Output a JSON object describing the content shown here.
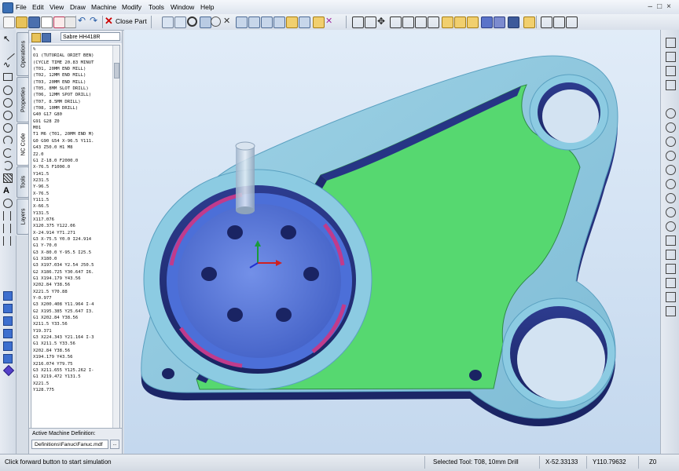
{
  "menu": [
    "File",
    "Edit",
    "View",
    "Draw",
    "Machine",
    "Modify",
    "Tools",
    "Window",
    "Help"
  ],
  "toolbar": {
    "close_part_label": "Close Part"
  },
  "left_tools": [
    "pointer-icon",
    "line-icon",
    "polyline-icon",
    "rectangle-icon",
    "circle-icon",
    "circle-3pt-icon",
    "circle-icon",
    "circle-icon",
    "arc-icon",
    "arc-icon",
    "arc-icon",
    "hatch-icon",
    "text-icon",
    "circle-icon",
    "dimension-icon",
    "dimension-icon",
    "dimension-icon"
  ],
  "side_tabs": [
    "Operations",
    "Properties",
    "NC Code",
    "Tools",
    "Layers"
  ],
  "nc_panel": {
    "machine": "Sabre HH418R",
    "code_lines": [
      "%",
      "O1 (TUTORIAL ORIET BEN)",
      "(CYCLE TIME 20.83 MINUT",
      "(T01, 20MM END MILL)",
      "(T02, 12MM END MILL)",
      "(T03, 20MM END MILL)",
      "(T05, 8MM SLOT DRILL)",
      "(T06, 12MM SPOT DRILL)",
      "(T07, 8.5MM DRILL)",
      "(T08, 10MM DRILL)",
      "G40 G17 G80",
      "G91 G28 Z0",
      "M01",
      "T1 M6 (T01, 20MM END M)",
      "G0 G90 G54 X-96.5 Y111.",
      "G43 Z50.0 H1 M8",
      "Z2.0",
      "G1 Z-18.0 F2000.0",
      "X-76.5 F1000.0",
      "Y141.5",
      "X231.5",
      "Y-96.5",
      "X-76.5",
      "Y111.5",
      "X-66.5",
      "Y131.5",
      "X117.076",
      "X120.375 Y122.06",
      "X-24.914 Y71.271",
      "G3 X-75.5 Y0.0 I24.914",
      "G1 Y-70.0",
      "G3 X-80.0 Y-95.5 I25.5",
      "G1 X180.0",
      "G3 X197.034 Y2.54 J50.5",
      "G2 X186.725 Y30.647 I6.",
      "G1 X194.179 Y43.56",
      "X202.84 Y38.56",
      "X221.5 Y70.88",
      "Y-0.977",
      "G3 X200.408 Y11.964 I-4",
      "G2 X195.385 Y25.647 I3.",
      "G1 X202.84 Y38.56",
      "X211.5 Y33.56",
      "Y19.371",
      "G3 X224.343 Y21.164 I-3",
      "G1 X211.5 Y33.56",
      "X202.84 Y38.56",
      "X194.179 Y43.56",
      "X216.074 Y79.75",
      "G3 X211.655 Y125.262 I-",
      "G1 X219.472 Y131.5",
      "X221.5",
      "Y128.775"
    ],
    "active_machine_label": "Active Machine Definition:",
    "machine_definition_path": "Definitions\\Fanuc\\Fanuc.mdf",
    "browse_label": "..."
  },
  "status": {
    "message": "Click forward button to start simulation",
    "selected_tool": "Selected Tool: T08, 10mm Drill",
    "x": "X-52.33133",
    "y": "Y110.79632",
    "z": "Z0"
  }
}
